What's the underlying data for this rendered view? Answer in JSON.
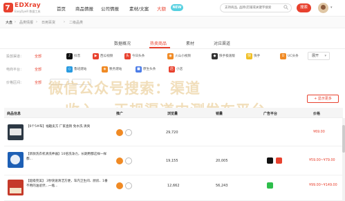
{
  "brand": {
    "name": "EDXray",
    "tagline": "EasyDyeR 数据工具"
  },
  "nav": {
    "items": [
      {
        "label": "首页",
        "active": false
      },
      {
        "label": "商品情报",
        "active": false
      },
      {
        "label": "公司情报",
        "active": false
      },
      {
        "label": "素材/文案",
        "active": false
      },
      {
        "label": "大额",
        "active": true
      }
    ],
    "badge": "NEW"
  },
  "search": {
    "placeholder": "支持商品, 品牌/店铺或关键字搜索",
    "button": "搜索"
  },
  "breadcrumb": [
    "大盘",
    "品类情报",
    "日用百货",
    "二级品类"
  ],
  "tabs": {
    "items": [
      "数据概况",
      "热卖商品",
      "素材",
      "对应渠道"
    ],
    "active_index": 1
  },
  "filters": {
    "row1": {
      "label": "投放渠道：",
      "all": "全部",
      "platforms": [
        {
          "name": "抖音",
          "color": "#111111",
          "glyph": "♪"
        },
        {
          "name": "西瓜视频",
          "color": "#e8412e",
          "glyph": "▶"
        },
        {
          "name": "今日头条",
          "color": "#e8412e",
          "glyph": "头"
        },
        {
          "name": "火山小视频",
          "color": "#f08a24",
          "glyph": "◉"
        },
        {
          "name": "快手极速版",
          "color": "#333333",
          "glyph": "◆"
        },
        {
          "name": "快手",
          "color": "#f0bf24",
          "glyph": "快"
        },
        {
          "name": "UC头条",
          "color": "#f08a24",
          "glyph": "U"
        }
      ],
      "expand": "展开"
    },
    "row2": {
      "label": "电商平台：",
      "all": "全部",
      "platforms": [
        {
          "name": "鲁班建站",
          "color": "#2a9be0",
          "glyph": "◇"
        },
        {
          "name": "税务建站",
          "color": "#f08a24",
          "glyph": "◈"
        },
        {
          "name": "原生头条",
          "color": "#4b7ce8",
          "glyph": "■"
        },
        {
          "name": "小店",
          "color": "#e8412e",
          "glyph": "店"
        }
      ]
    },
    "row3": {
      "label": "价格区间：",
      "all": "全部"
    }
  },
  "watermark": [
    "微信公众号搜索：渠道",
    "收入...正规渠道内测发布平台"
  ],
  "add_button": "+ 显示更多",
  "table": {
    "headers": [
      "商品信息",
      "推广",
      "浏览量",
      "销量",
      "广告平台",
      "价格"
    ],
    "rows": [
      {
        "name": "【6个5#布】福趣卖方 厂家直销 免水洗 清爽",
        "views": "29,720",
        "sales": "",
        "price": "¥69.00",
        "thumb": "#2c3844"
      },
      {
        "name": "【新款洗衣机清洗神器】10倍洗净力，长期用都这样一样都...",
        "views": "19,155",
        "sales": "20,005",
        "price": "¥59.00~¥79.00",
        "thumb": "#1d5fb5"
      },
      {
        "name": "【超级完美】 3秒快速清洁方便，车内卫生间、厨房、1番不用的油迹然...一瓶...",
        "views": "12,662",
        "sales": "56,243",
        "price": "¥99.00~¥149.00",
        "thumb": "#c53a2a"
      }
    ]
  },
  "colors": {
    "accent": "#e8412e",
    "badge": "#56d0e0"
  }
}
